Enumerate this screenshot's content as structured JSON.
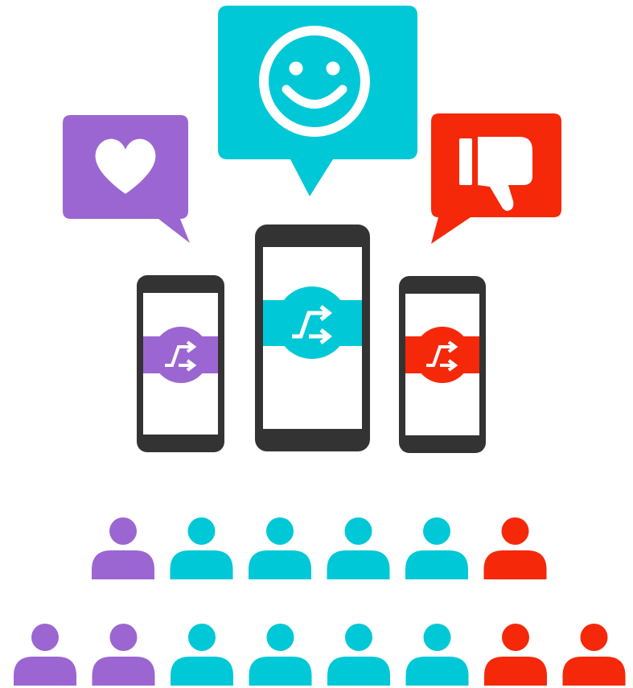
{
  "colors": {
    "purple": "#9b66d1",
    "cyan": "#00c8d6",
    "red": "#f5280a",
    "phone": "#333333",
    "screen": "#ffffff"
  },
  "bubbles": [
    {
      "icon": "heart-icon",
      "color": "purple"
    },
    {
      "icon": "smiley-icon",
      "color": "cyan"
    },
    {
      "icon": "thumbs-down-icon",
      "color": "red"
    }
  ],
  "phones": [
    {
      "color": "purple",
      "icon": "shuffle-icon"
    },
    {
      "color": "cyan",
      "icon": "shuffle-icon"
    },
    {
      "color": "red",
      "icon": "shuffle-icon"
    }
  ],
  "audience": {
    "row1": [
      "purple",
      "cyan",
      "cyan",
      "cyan",
      "cyan",
      "red"
    ],
    "row2": [
      "purple",
      "purple",
      "cyan",
      "cyan",
      "cyan",
      "cyan",
      "red",
      "red"
    ]
  }
}
